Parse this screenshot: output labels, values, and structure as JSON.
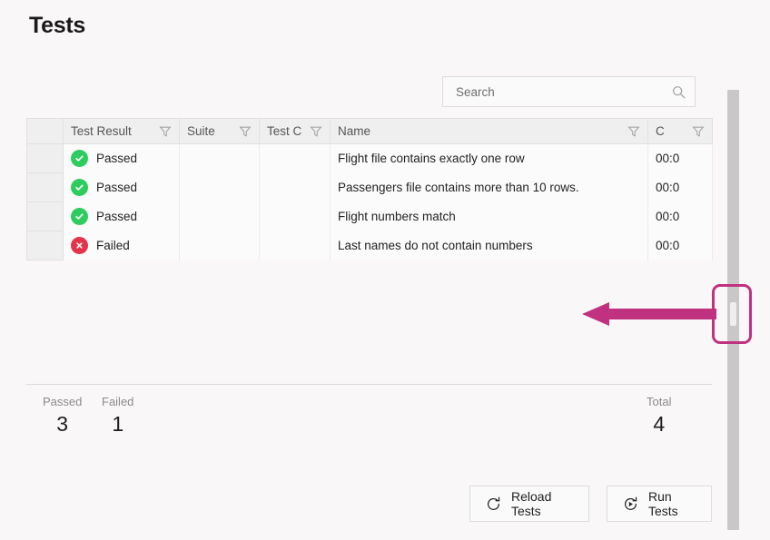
{
  "page": {
    "title": "Tests",
    "background_color": "#faf7f8"
  },
  "search": {
    "value": "",
    "placeholder": "Search",
    "icon": "search-icon"
  },
  "table": {
    "columns": [
      {
        "label": "",
        "filter": false,
        "key": "select"
      },
      {
        "label": "Test Result",
        "filter": true,
        "key": "test_result"
      },
      {
        "label": "Suite",
        "filter": true,
        "key": "suite"
      },
      {
        "label": "Test C",
        "filter": true,
        "key": "test_class"
      },
      {
        "label": "Name",
        "filter": true,
        "key": "name"
      },
      {
        "label": "C",
        "filter": true,
        "key": "duration"
      }
    ],
    "rows": [
      {
        "status": "Passed",
        "status_icon": "check-circle-icon",
        "suite": "",
        "test_class": "",
        "name": "Flight file contains exactly one row",
        "duration": "00:0"
      },
      {
        "status": "Passed",
        "status_icon": "check-circle-icon",
        "suite": "",
        "test_class": "",
        "name": "Passengers file contains more than 10 rows.",
        "duration": "00:0"
      },
      {
        "status": "Passed",
        "status_icon": "check-circle-icon",
        "suite": "",
        "test_class": "",
        "name": "Flight numbers match",
        "duration": "00:0"
      },
      {
        "status": "Failed",
        "status_icon": "x-circle-icon",
        "suite": "",
        "test_class": "",
        "name": "Last names do not contain numbers",
        "duration": "00:0"
      }
    ]
  },
  "summary": {
    "passed_label": "Passed",
    "passed_value": "3",
    "failed_label": "Failed",
    "failed_value": "1",
    "total_label": "Total",
    "total_value": "4"
  },
  "actions": {
    "reload_label": "Reload Tests",
    "reload_icon": "refresh-icon",
    "run_label": "Run Tests",
    "run_icon": "play-circle-icon"
  },
  "annotation": {
    "highlight_color": "#c0317f",
    "arrow_color": "#c0317f",
    "target": "page-scrollbar-thumb"
  },
  "colors": {
    "passed": "#2ecc5f",
    "failed": "#e2344a",
    "failed_row_background": "#f56bb4",
    "header_background": "#f0efef",
    "scrollbar_track": "#c9c7c7"
  }
}
